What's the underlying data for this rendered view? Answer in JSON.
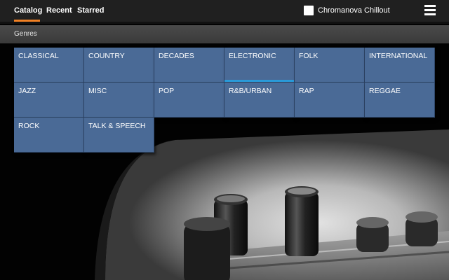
{
  "nav": {
    "tabs": [
      "Catalog",
      "Recent",
      "Starred"
    ],
    "active_tab": "Catalog"
  },
  "now_playing": {
    "station": "Chromanova Chillout"
  },
  "section": {
    "title": "Genres"
  },
  "genres": [
    "CLASSICAL",
    "COUNTRY",
    "DECADES",
    "ELECTRONIC",
    "FOLK",
    "INTERNATIONAL",
    "JAZZ",
    "MISC",
    "POP",
    "R&B/URBAN",
    "RAP",
    "REGGAE",
    "ROCK",
    "TALK & SPEECH"
  ],
  "selected_genre": "ELECTRONIC",
  "colors": {
    "accent": "#f08024",
    "tile": "#4a6a96",
    "selection": "#2a9ad8"
  },
  "icons": {
    "menu": "hamburger-menu-icon",
    "station": "station-checkbox-icon"
  }
}
